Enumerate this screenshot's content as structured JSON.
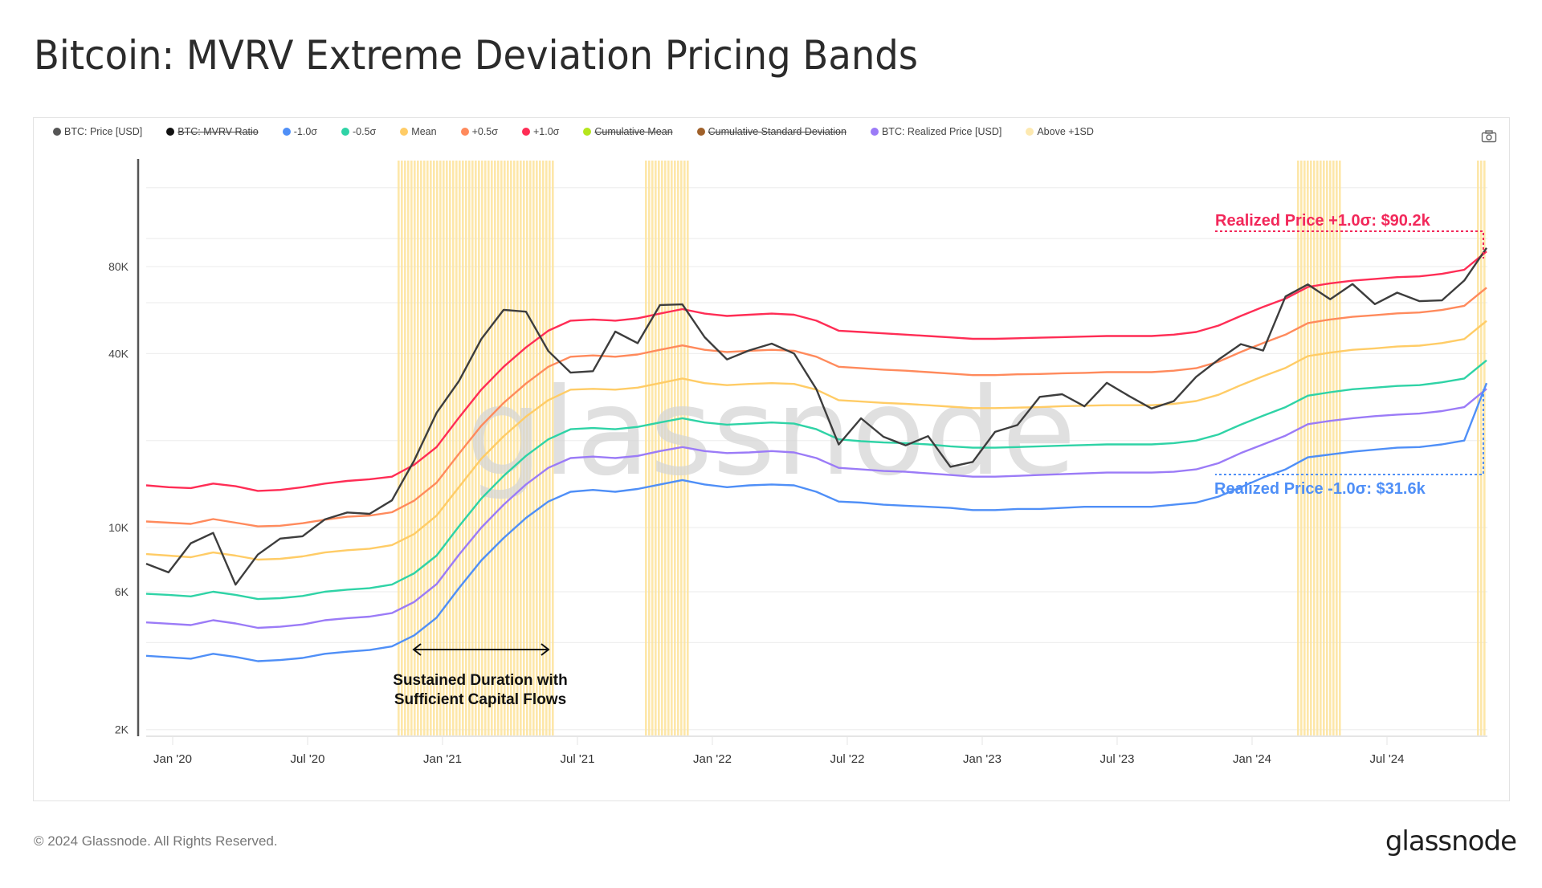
{
  "title": "Bitcoin: MVRV Extreme Deviation Pricing Bands",
  "legend": [
    {
      "label": "BTC: Price [USD]",
      "color": "#555555",
      "struck": false
    },
    {
      "label": "BTC: MVRV Ratio",
      "color": "#111111",
      "struck": true
    },
    {
      "label": "-1.0σ",
      "color": "#4f8ff7",
      "struck": false
    },
    {
      "label": "-0.5σ",
      "color": "#2fd3a6",
      "struck": false
    },
    {
      "label": "Mean",
      "color": "#ffcc66",
      "struck": false
    },
    {
      "label": "+0.5σ",
      "color": "#ff8a5c",
      "struck": false
    },
    {
      "label": "+1.0σ",
      "color": "#ff2d55",
      "struck": false
    },
    {
      "label": "Cumulative Mean",
      "color": "#b5e61d",
      "struck": true
    },
    {
      "label": "Cumulative Standard Deviation",
      "color": "#a0612a",
      "struck": true
    },
    {
      "label": "BTC: Realized Price [USD]",
      "color": "#9b7bf7",
      "struck": false
    },
    {
      "label": "Above +1SD",
      "color": "#fde9b0",
      "struck": false
    }
  ],
  "camera_icon": "camera-icon",
  "watermark": "glassnode",
  "annotations": {
    "upper": "Realized Price +1.0σ: $90.2k",
    "lower": "Realized Price -1.0σ: $31.6k",
    "arrow_line1": "Sustained Duration with",
    "arrow_line2": "Sufficient Capital Flows",
    "upper_color": "#f2285a",
    "lower_color": "#4f8ff7"
  },
  "footer": {
    "copyright": "© 2024 Glassnode. All Rights Reserved.",
    "logo": "glassnode"
  },
  "chart_data": {
    "type": "line",
    "title": "Bitcoin: MVRV Extreme Deviation Pricing Bands",
    "yscale": "log",
    "ylim": [
      1800,
      150000
    ],
    "yticks": [
      {
        "v": 2000,
        "label": "2K"
      },
      {
        "v": 6000,
        "label": "6K"
      },
      {
        "v": 10000,
        "label": "10K"
      },
      {
        "v": 40000,
        "label": "40K"
      },
      {
        "v": 80000,
        "label": "80K"
      }
    ],
    "xticks": [
      "Jan '20",
      "Jul '20",
      "Jan '21",
      "Jul '21",
      "Jan '22",
      "Jul '22",
      "Jan '23",
      "Jul '23",
      "Jan '24",
      "Jul '24"
    ],
    "x_start": "2019-11",
    "x_months": [
      "2019-11",
      "2019-12",
      "2020-01",
      "2020-02",
      "2020-03",
      "2020-04",
      "2020-05",
      "2020-06",
      "2020-07",
      "2020-08",
      "2020-09",
      "2020-10",
      "2020-11",
      "2020-12",
      "2021-01",
      "2021-02",
      "2021-03",
      "2021-04",
      "2021-05",
      "2021-06",
      "2021-07",
      "2021-08",
      "2021-09",
      "2021-10",
      "2021-11",
      "2021-12",
      "2022-01",
      "2022-02",
      "2022-03",
      "2022-04",
      "2022-05",
      "2022-06",
      "2022-07",
      "2022-08",
      "2022-09",
      "2022-10",
      "2022-11",
      "2022-12",
      "2023-01",
      "2023-02",
      "2023-03",
      "2023-04",
      "2023-05",
      "2023-06",
      "2023-07",
      "2023-08",
      "2023-09",
      "2023-10",
      "2023-11",
      "2023-12",
      "2024-01",
      "2024-02",
      "2024-03",
      "2024-04",
      "2024-05",
      "2024-06",
      "2024-07",
      "2024-08",
      "2024-09",
      "2024-10",
      "2024-11"
    ],
    "series": [
      {
        "name": "+1.0σ",
        "color": "#ff2d55",
        "values": [
          14000,
          13800,
          13700,
          14200,
          13900,
          13400,
          13500,
          13800,
          14200,
          14500,
          14700,
          15000,
          16500,
          19000,
          24000,
          30000,
          36000,
          42000,
          48000,
          52000,
          52500,
          52000,
          53000,
          55000,
          57000,
          55000,
          54000,
          54500,
          55000,
          54500,
          52000,
          48000,
          47500,
          47000,
          46500,
          46000,
          45500,
          45000,
          45000,
          45200,
          45400,
          45600,
          45800,
          46000,
          46000,
          46000,
          46500,
          47500,
          50000,
          54000,
          58000,
          62000,
          68000,
          70000,
          71500,
          72500,
          73500,
          74000,
          75500,
          78000,
          90200
        ]
      },
      {
        "name": "+0.5σ",
        "color": "#ff8a5c",
        "values": [
          10500,
          10400,
          10300,
          10700,
          10400,
          10100,
          10150,
          10350,
          10650,
          10900,
          11000,
          11300,
          12400,
          14300,
          18000,
          22500,
          27000,
          31500,
          36000,
          39000,
          39400,
          39000,
          39700,
          41200,
          42700,
          41200,
          40500,
          40900,
          41200,
          40900,
          39000,
          36000,
          35600,
          35200,
          34900,
          34500,
          34100,
          33700,
          33700,
          33900,
          34000,
          34200,
          34300,
          34500,
          34500,
          34500,
          34900,
          35600,
          37500,
          40500,
          43500,
          46500,
          51000,
          52500,
          53600,
          54300,
          55100,
          55500,
          56600,
          58500,
          67600
        ]
      },
      {
        "name": "Mean",
        "color": "#ffcc66",
        "values": [
          8100,
          8000,
          7900,
          8200,
          8000,
          7750,
          7800,
          7950,
          8200,
          8350,
          8450,
          8700,
          9500,
          11000,
          13800,
          17300,
          20700,
          24200,
          27600,
          30000,
          30200,
          30000,
          30500,
          31600,
          32800,
          31600,
          31100,
          31400,
          31600,
          31400,
          30000,
          27600,
          27300,
          27000,
          26800,
          26500,
          26200,
          25900,
          25900,
          26000,
          26100,
          26300,
          26400,
          26500,
          26500,
          26500,
          26800,
          27400,
          28800,
          31100,
          33400,
          35700,
          39200,
          40300,
          41200,
          41700,
          42300,
          42600,
          43500,
          44900,
          51900
        ]
      },
      {
        "name": "-0.5σ",
        "color": "#2fd3a6",
        "values": [
          5900,
          5850,
          5780,
          6000,
          5850,
          5660,
          5700,
          5800,
          6000,
          6100,
          6170,
          6350,
          6950,
          8000,
          10100,
          12600,
          15100,
          17700,
          20200,
          21900,
          22100,
          21900,
          22300,
          23100,
          23900,
          23100,
          22700,
          22900,
          23100,
          22900,
          21900,
          20200,
          19900,
          19700,
          19600,
          19400,
          19100,
          18900,
          18900,
          19000,
          19100,
          19200,
          19300,
          19400,
          19400,
          19400,
          19600,
          20000,
          21000,
          22700,
          24400,
          26100,
          28600,
          29400,
          30100,
          30500,
          30900,
          31100,
          31800,
          32800,
          37900
        ]
      },
      {
        "name": "BTC: Realized Price [USD]",
        "color": "#9b7bf7",
        "values": [
          4700,
          4650,
          4600,
          4780,
          4660,
          4500,
          4540,
          4620,
          4780,
          4860,
          4920,
          5060,
          5530,
          6370,
          8050,
          10000,
          12000,
          14100,
          16100,
          17400,
          17600,
          17400,
          17700,
          18400,
          19000,
          18400,
          18100,
          18200,
          18400,
          18200,
          17400,
          16100,
          15900,
          15700,
          15600,
          15400,
          15200,
          15000,
          15000,
          15100,
          15200,
          15300,
          15400,
          15500,
          15500,
          15500,
          15600,
          15900,
          16700,
          18100,
          19400,
          20800,
          22800,
          23400,
          23900,
          24300,
          24600,
          24800,
          25300,
          26100,
          30200
        ]
      },
      {
        "name": "-1.0σ",
        "color": "#4f8ff7",
        "values": [
          3600,
          3560,
          3520,
          3660,
          3570,
          3450,
          3480,
          3540,
          3660,
          3720,
          3770,
          3880,
          4240,
          4880,
          6170,
          7700,
          9200,
          10800,
          12300,
          13300,
          13500,
          13300,
          13600,
          14100,
          14600,
          14100,
          13800,
          14000,
          14100,
          14000,
          13300,
          12300,
          12200,
          12000,
          11900,
          11800,
          11700,
          11500,
          11500,
          11600,
          11600,
          11700,
          11800,
          11800,
          11800,
          11800,
          12000,
          12200,
          12800,
          13800,
          14900,
          15900,
          17500,
          17900,
          18300,
          18600,
          18900,
          19000,
          19400,
          20000,
          31600
        ]
      },
      {
        "name": "BTC: Price [USD]",
        "color": "#3d3d3d",
        "values": [
          7500,
          7200,
          8500,
          9800,
          6400,
          7800,
          9500,
          9200,
          10500,
          11700,
          10800,
          12500,
          17500,
          24000,
          33000,
          45000,
          55000,
          58000,
          40000,
          34000,
          36000,
          46000,
          44000,
          60000,
          57000,
          47000,
          38000,
          40000,
          45000,
          39000,
          30000,
          20000,
          23000,
          21000,
          19500,
          20000,
          16800,
          16700,
          21000,
          23500,
          27500,
          29000,
          27000,
          30500,
          29200,
          26000,
          26500,
          34500,
          37500,
          42500,
          42500,
          61000,
          70000,
          63000,
          67000,
          61000,
          65000,
          59000,
          63500,
          70000,
          92000
        ]
      }
    ],
    "above_1sd_periods": [
      [
        "2020-11",
        "2020-12"
      ],
      [
        "2021-01",
        "2021-05"
      ],
      [
        "2021-10",
        "2021-11"
      ],
      [
        "2024-03",
        "2024-04"
      ],
      [
        "2024-11",
        "2024-11"
      ]
    ],
    "annotations": [
      {
        "text": "Realized Price +1.0σ: $90.2k",
        "value": 90200
      },
      {
        "text": "Realized Price -1.0σ: $31.6k",
        "value": 31600
      },
      {
        "text": "Sustained Duration with Sufficient Capital Flows",
        "from": "2020-11",
        "to": "2021-05"
      }
    ]
  }
}
